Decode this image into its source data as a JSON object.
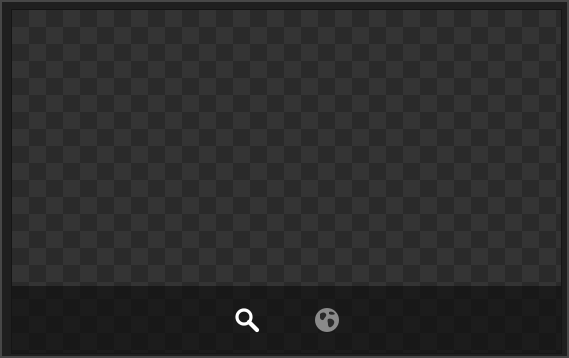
{
  "panel": {
    "background": "checkerboard-transparency",
    "colors": {
      "frame": "#474747",
      "checker_dark": "#2a2a2a",
      "checker_light": "#343434",
      "toolbar_bg": "#0a0a0a",
      "search_icon": "#ffffff",
      "globe_icon": "#8a8a8a"
    }
  },
  "toolbar": {
    "buttons": [
      {
        "icon": "search-icon",
        "state": "active"
      },
      {
        "icon": "globe-icon",
        "state": "inactive"
      }
    ]
  }
}
